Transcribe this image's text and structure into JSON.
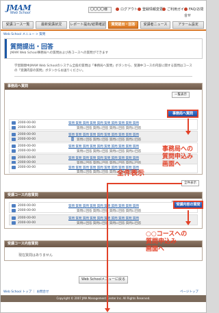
{
  "header": {
    "logo_top": "JMAM",
    "logo_bottom": "Web School",
    "user_name": "〇〇〇〇様",
    "links": [
      "ログアウト",
      "登録情報変更",
      "ご利用ガイド",
      "FAQ/お問合せ"
    ]
  },
  "nav": {
    "tabs": [
      "受講コース一覧",
      "最新受講状況",
      "レポート提出/結果確認",
      "質問提出・回答",
      "受講者ニュース",
      "アラーム設定"
    ],
    "active_index": 3
  },
  "breadcrumb": "Web School メニュー > 質問",
  "title": {
    "heading": "質問提出・回答",
    "subtitle": "JMAM Web School事務局への質問および各コースへの質問ができます"
  },
  "intro": "学習期間中JMAM Web Schoolのシステム全般の質問は「事務局へ質問」ボタンから、受講中コースの内容に関する質問はコースの「受講内容の質問」ボタンからお送りください。",
  "office_section": {
    "header": "事務局へ質問",
    "list_button": "一覧表示",
    "action_button": "事務局へ質問",
    "rows": [
      {
        "d1": "2000-00-00",
        "d2": "2000-00-00",
        "title": "質問 質問 質問 質問 質問 質問 質問 質問 質問 質問",
        "body": "質問に回答 質問に回答 質問に回答 質問に回答"
      },
      {
        "d1": "2000-00-00",
        "d2": "2000-00-00",
        "title": "質問 質問 質問 質問 質問 質問 質問 質問 質問 質問",
        "body": "質問に回答 質問に回答 質問に回答 質問に回答"
      },
      {
        "d1": "2000-00-00",
        "d2": "2000-00-00",
        "title": "質問 質問 質問 質問 質問 質問 質問 質問 質問 質問",
        "body": "質問に回答 質問に回答 質問に回答 質問に回答"
      },
      {
        "d1": "2000-00-00",
        "d2": "2000-00-00",
        "title": "質問 質問 質問 質問 質問 質問 質問 質問 質問 質問",
        "body": "質問に回答 質問に回答 質問に回答 質問に回答"
      },
      {
        "d1": "2000-00-00",
        "d2": "2000-00-00",
        "title": "質問 質問 質問 質問 質問 質問 質問 質問 質問 質問",
        "body": "質問に回答 質問に回答 質問に回答 質問に回答"
      }
    ],
    "show_all": "全件表示"
  },
  "course_section": {
    "header": "受講コース内容質問",
    "list_button": "一覧表示",
    "action_button": "受講内容の質問",
    "rows": [
      {
        "d1": "2000-00-00",
        "d2": "2000-00-00",
        "title": "質問 質問 質問 質問 質問 質問 質問 質問 質問 質問",
        "body": "質問に回答 質問に回答 質問に回答 質問に回答"
      },
      {
        "d1": "2000-00-00",
        "d2": "2000-00-00",
        "title": "質問 質問 質問 質問 質問 質問 質問 質問 質問 質問",
        "body": "質問に回答 質問に回答 質問に回答 質問に回答"
      }
    ]
  },
  "course_section2": {
    "header": "受講コース内容質問",
    "empty_text": "現在質問はありません"
  },
  "annotations": {
    "office": [
      "事務局への",
      "質問申込み",
      "画面へ"
    ],
    "show_all": "全件表示",
    "course": [
      "○○コースへの",
      "質問申込み",
      "画面へ"
    ]
  },
  "bottom": {
    "menu_button": "Web Schoolメニューに戻る",
    "footer_links": "Web School トップ ｜ お問合せ",
    "page_top": "ページトップ",
    "copyright": "Copyright © 2007 JMA Management Center Inc. All Rights Reserved."
  },
  "colors": {
    "accent": "#d8731f",
    "brand": "#1c58a5",
    "annotation": "#e24128",
    "section_header": "#7b6a5b"
  }
}
